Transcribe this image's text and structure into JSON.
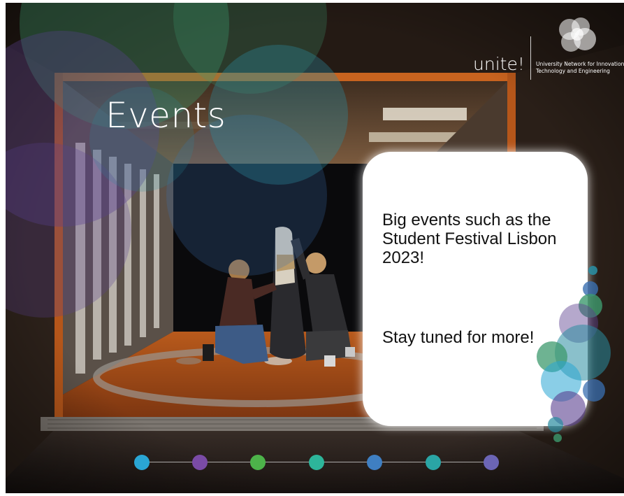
{
  "slide": {
    "title": "Events",
    "logo": {
      "wordmark": "unite!",
      "subtitle_line_1": "University Network for Innovation",
      "subtitle_line_2": "Technology and Engineering"
    },
    "card": {
      "paragraph_1": "Big events such as the Student Festival Lisbon 2023!",
      "paragraph_2": "Stay tuned for more!"
    },
    "timeline_dot_colors": [
      "#2aa6d4",
      "#7a4ba6",
      "#4db34a",
      "#2db59a",
      "#3f7fc2",
      "#2aa5a5",
      "#6b65b5"
    ]
  },
  "colors": {
    "title_text": "#ffffff",
    "card_background": "#ffffff",
    "card_text": "#111111",
    "bubble_green": "#3d9a6e",
    "bubble_teal": "#2a8ca0",
    "bubble_purple": "#5a3f8f",
    "bubble_blue": "#3a6fb0"
  }
}
